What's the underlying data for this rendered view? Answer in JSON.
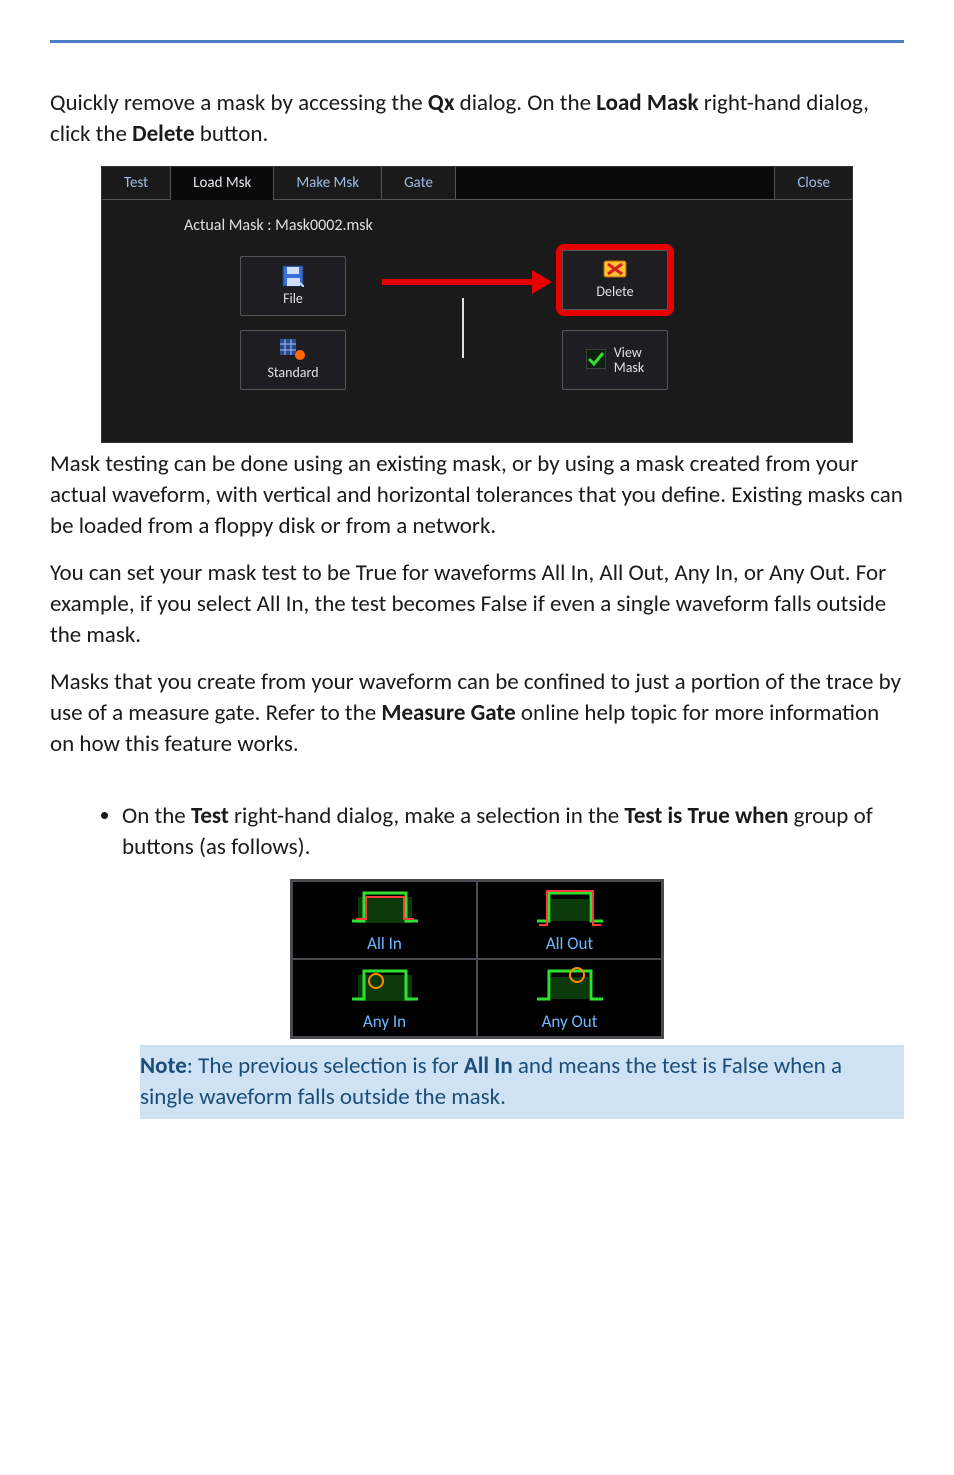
{
  "intro1_part1": "Quickly remove a mask by accessing the ",
  "intro1_b1": "Qx",
  "intro1_part2": " dialog. On the ",
  "intro1_b2": "Load Mask",
  "intro1_part3": " right-hand dialog, click the ",
  "intro1_b3": "Delete",
  "intro1_part4": " button.",
  "dialog": {
    "tabs": {
      "test": "Test",
      "load_msk": "Load Msk",
      "make_msk": "Make Msk",
      "gate": "Gate",
      "close": "Close"
    },
    "actual_mask": "Actual Mask : Mask0002.msk",
    "buttons": {
      "file": "File",
      "standard": "Standard",
      "delete": "Delete",
      "view_mask_line1": "View",
      "view_mask_line2": "Mask"
    }
  },
  "para2": "Mask testing can be done using an existing mask, or by using a mask created from your actual waveform, with vertical and horizontal tolerances that you define. Existing masks can be loaded from a floppy disk or from a network.",
  "para3": "You can set your mask test to be True for waveforms All In, All Out, Any In, or Any Out. For example, if you select All In, the test becomes False if even a single waveform falls outside the mask.",
  "para4_part1": "Masks that you create from your waveform can be confined to just a portion of the trace by use of a measure gate. Refer to the ",
  "para4_b1": "Measure Gate",
  "para4_part2": " online help topic for more information on how this feature works.",
  "bullet1_part1": "On the ",
  "bullet1_b1": "Test",
  "bullet1_part2": " right-hand dialog, make a selection in the ",
  "bullet1_b2": "Test is True when",
  "bullet1_part3": " group of buttons (as follows).",
  "options": {
    "all_in": "All In",
    "all_out": "All Out",
    "any_in": "Any In",
    "any_out": "Any Out"
  },
  "note_b1": "Note",
  "note_part1": ": The previous selection is for ",
  "note_b2": "All In",
  "note_part2": " and means the test is False when a single waveform falls outside the mask."
}
